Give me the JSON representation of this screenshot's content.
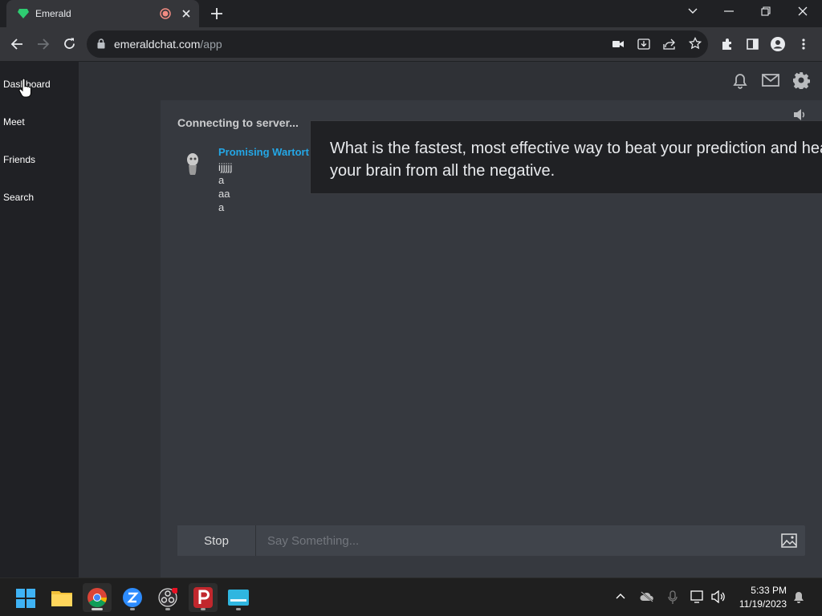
{
  "browser": {
    "tab": {
      "title": "Emerald"
    },
    "address": {
      "host": "emeraldchat.com",
      "path": "/app"
    }
  },
  "sidebar": {
    "items": [
      {
        "label": "Dashboard"
      },
      {
        "label": "Meet"
      },
      {
        "label": "Friends"
      },
      {
        "label": "Search"
      }
    ]
  },
  "chat": {
    "status": "Connecting to server...",
    "partner_name": "Promising Wartort",
    "messages": [
      "ijjjjj",
      "a",
      "aa",
      "a"
    ],
    "overlay_text": "What is the fastest, most effective way to beat your prediction and heal your brain from all the negative."
  },
  "composer": {
    "stop_label": "Stop",
    "placeholder": "Say Something..."
  },
  "taskbar": {
    "time": "5:33 PM",
    "date": "11/19/2023"
  },
  "colors": {
    "accent_name": "#24a7e6",
    "emerald": "#2ecc71"
  }
}
